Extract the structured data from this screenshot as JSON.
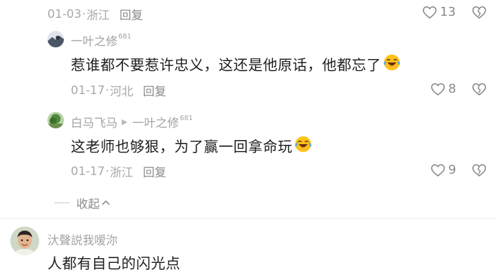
{
  "top_comment": {
    "date": "01-03",
    "location": "浙江",
    "reply_label": "回复",
    "likes": "13"
  },
  "reply1": {
    "username": "一叶之修",
    "badge": "681",
    "text": "惹谁都不要惹许忠义，这还是他原话，他都忘了",
    "emoji_icon": "laughing-crying-emoji-icon",
    "date": "01-17",
    "location": "河北",
    "reply_label": "回复",
    "likes": "8"
  },
  "reply2": {
    "username": "白马飞马",
    "reply_to": "一叶之修",
    "reply_to_badge": "681",
    "text": "这老师也够狠，为了赢一回拿命玩",
    "emoji_icon": "laughing-crying-emoji-icon",
    "date": "01-17",
    "location": "浙江",
    "reply_label": "回复",
    "likes": "9"
  },
  "collapse_label": "收起",
  "comment3": {
    "username": "汏聲説我嗳沵",
    "text": "人都有自己的闪光点"
  },
  "separator": "·",
  "colors": {
    "text": "#1f1f1f",
    "meta": "#a8a8a8",
    "icon": "#8a8a8a"
  }
}
